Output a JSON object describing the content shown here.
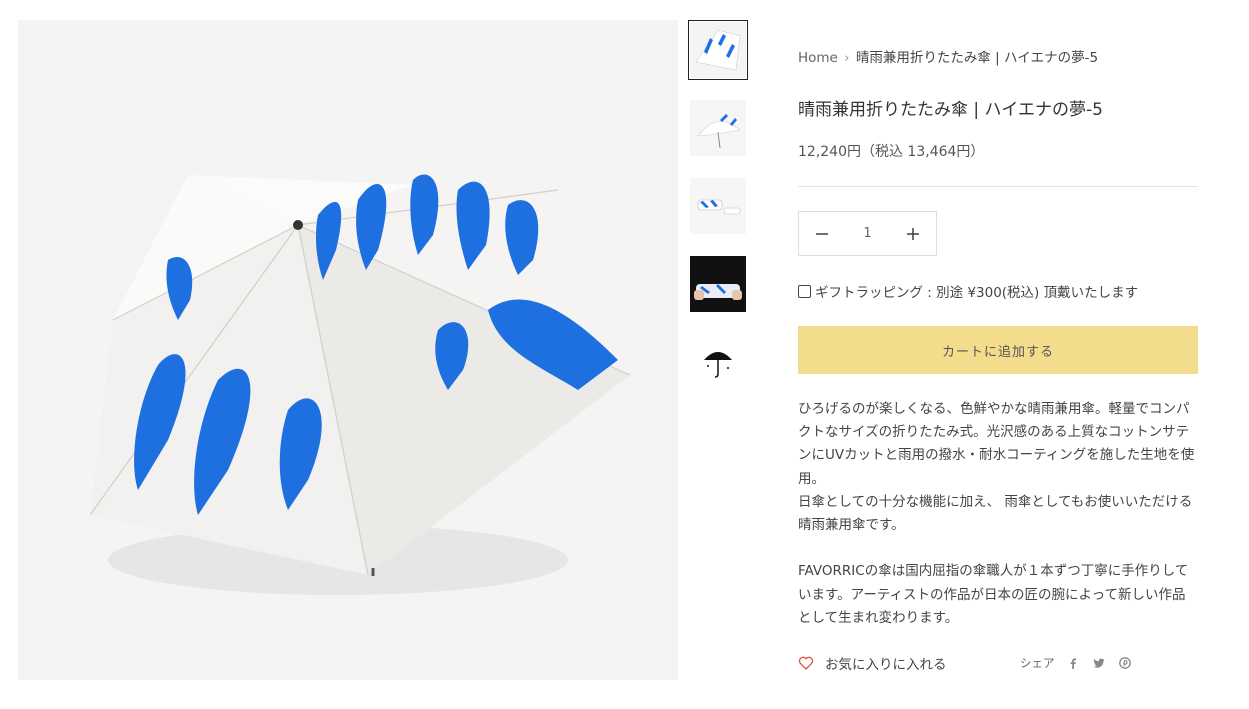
{
  "breadcrumb": {
    "home": "Home",
    "separator": "›",
    "current": "晴雨兼用折りたたみ傘 | ハイエナの夢-5"
  },
  "product": {
    "title": "晴雨兼用折りたたみ傘 | ハイエナの夢-5",
    "price": "12,240円（税込 13,464円）",
    "quantity": "1",
    "gift_label": "ギフトラッピング : 別途 ¥300(税込) 頂戴いたします",
    "add_to_cart": "カートに追加する",
    "description": [
      "ひろげるのが楽しくなる、色鮮やかな晴雨兼用傘。軽量でコンパクトなサイズの折りたたみ式。光沢感のある上質なコットンサテンにUVカットと雨用の撥水・耐水コーティングを施した生地を使用。",
      "日傘としての十分な機能に加え、 雨傘としてもお使いいただける晴雨兼用傘です。",
      "FAVORRICの傘は国内屈指の傘職人が１本ずつ丁寧に手作りしています。アーティストの作品が日本の匠の腕によって新しい作品として生まれ変わります。"
    ]
  },
  "actions": {
    "favorite": "お気に入りに入れる",
    "share": "シェア",
    "share_icons": [
      "facebook-icon",
      "twitter-icon",
      "pinterest-icon"
    ]
  },
  "thumbnails": [
    {
      "name": "thumb-umbrella-top",
      "active": true
    },
    {
      "name": "thumb-umbrella-side",
      "active": false
    },
    {
      "name": "thumb-umbrella-folded",
      "active": false
    },
    {
      "name": "thumb-umbrella-held",
      "active": false
    },
    {
      "name": "thumb-brand-logo",
      "active": false
    }
  ],
  "colors": {
    "accent_button": "#f3dc8c",
    "print_blue": "#1e6fe0",
    "heart": "#e0553a"
  }
}
